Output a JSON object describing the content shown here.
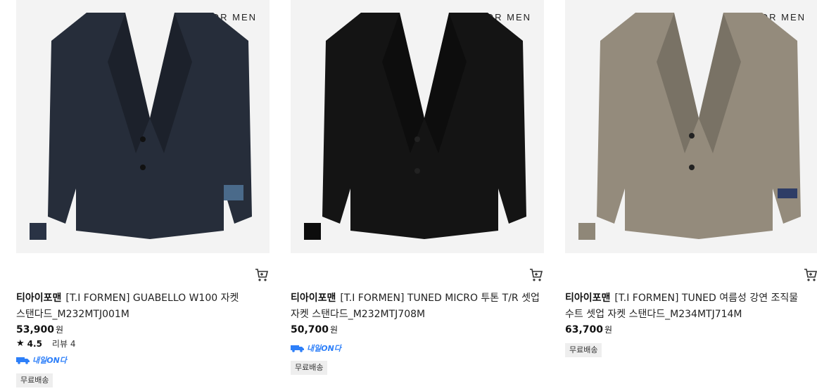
{
  "products": [
    {
      "watermark": "T·I FOR MEN",
      "brand": "티아이포맨",
      "name": "[T.I FORMEN] GUABELLO W100 자켓 스탠다드_M232MTJ001M",
      "price": "53,900",
      "currency": "원",
      "rating": "4.5",
      "review": "리뷰 4",
      "delivery": "내일ON다",
      "free_shipping": "무료배송",
      "jacket_color": "#262d3a",
      "swatch_color": "#2a3345"
    },
    {
      "watermark": "T·I FOR MEN",
      "brand": "티아이포맨",
      "name": "[T.I FORMEN] TUNED MICRO 투톤 T/R 셋업 자켓 스탠다드_M232MTJ708M",
      "price": "50,700",
      "currency": "원",
      "delivery": "내일ON다",
      "free_shipping": "무료배송",
      "jacket_color": "#141414",
      "swatch_color": "#0c0c0c"
    },
    {
      "watermark": "T·I FOR MEN",
      "brand": "티아이포맨",
      "name": "[T.I FORMEN] TUNED 여름성 강연 조직물 수트 셋업 자켓 스탠다드_M234MTJ714M",
      "price": "63,700",
      "currency": "원",
      "free_shipping": "무료배송",
      "jacket_color": "#948b7c",
      "swatch_color": "#8f8778"
    }
  ],
  "icons": {
    "cart": "cart-icon",
    "star": "star-icon",
    "delivery": "delivery-truck-icon"
  }
}
